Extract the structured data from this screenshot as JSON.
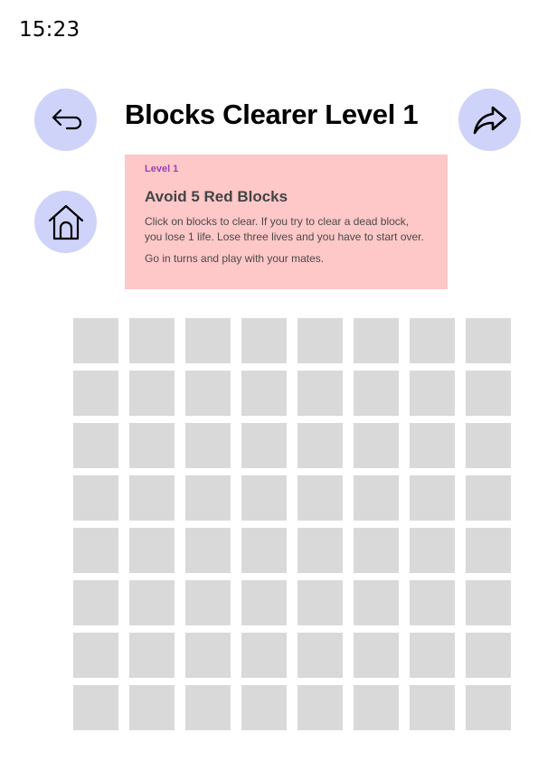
{
  "status_bar": {
    "time": "15:23"
  },
  "nav": {
    "back_icon": "return-arrow-icon",
    "forward_icon": "share-forward-arrow-icon",
    "home_icon": "home-icon"
  },
  "header": {
    "title": "Blocks Clearer Level 1"
  },
  "info_card": {
    "tag": "Level 1",
    "heading": "Avoid 5 Red Blocks",
    "body": "Click on blocks to clear. If you try to clear a dead block, you lose 1 life. Lose three lives and you have to start over.",
    "footer": "Go in turns and play with your mates."
  },
  "board": {
    "rows": 8,
    "columns": 8
  },
  "colors": {
    "button_bg": "#cfd3fa",
    "card_bg": "#fec7c8",
    "tag_color": "#9b42b8",
    "block_color": "#d9d9d9"
  }
}
